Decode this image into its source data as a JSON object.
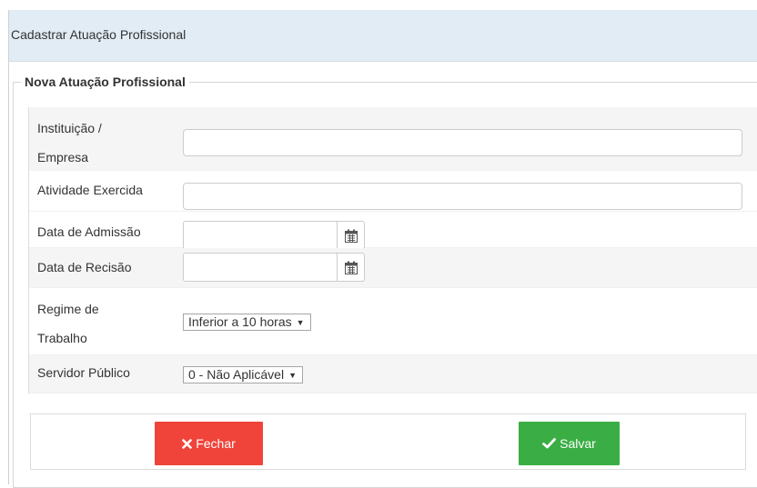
{
  "dialog": {
    "title": "Cadastrar Atuação Profissional"
  },
  "form": {
    "legend": "Nova Atuação Profissional",
    "fields": {
      "instituicao": {
        "label_line1": "Instituição /",
        "label_line2": "Empresa",
        "value": ""
      },
      "atividade": {
        "label": "Atividade Exercida",
        "value": ""
      },
      "admissao": {
        "label": "Data de Admissão",
        "value": "",
        "icon": "calendar-icon"
      },
      "recisao": {
        "label": "Data de Recisão",
        "value": "",
        "icon": "calendar-icon"
      },
      "regime": {
        "label_line1": "Regime de",
        "label_line2": "Trabalho",
        "selected": "Inferior a 10 horas"
      },
      "servidor": {
        "label": "Servidor Público",
        "selected": "0 - Não Aplicável"
      }
    }
  },
  "footer": {
    "close_label": "Fechar",
    "close_icon": "times-icon",
    "save_label": "Salvar",
    "save_icon": "check-icon"
  },
  "colors": {
    "header_bg": "#e2ecf4",
    "close_btn": "#f0443a",
    "save_btn": "#3aae44",
    "row_shade": "#f5f5f5"
  }
}
